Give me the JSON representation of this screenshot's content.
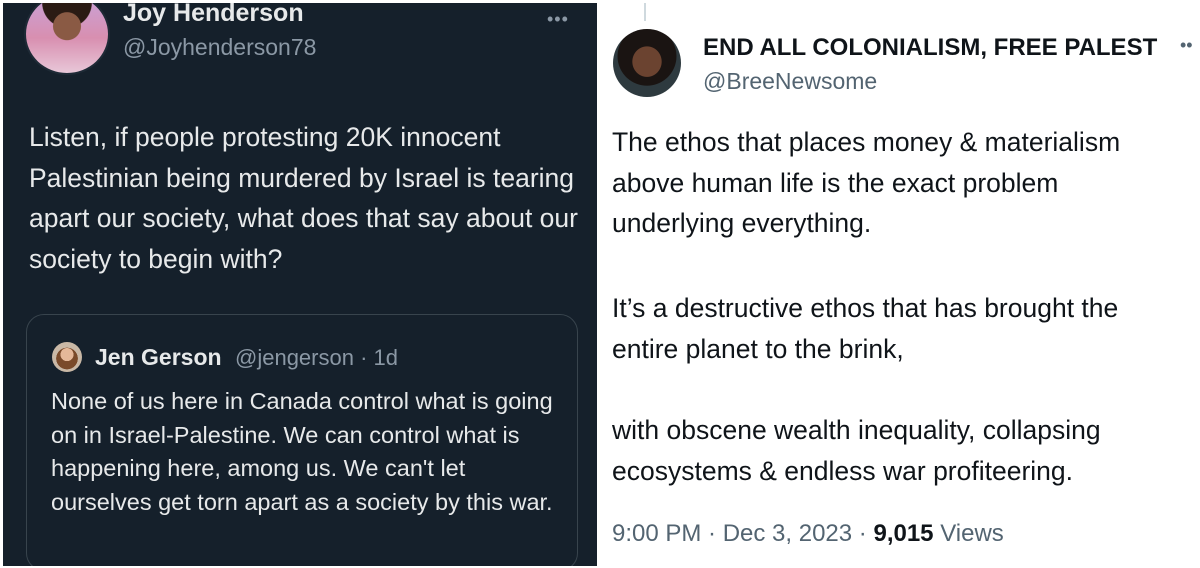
{
  "left_tweet": {
    "author_name": "Joy Henderson",
    "author_handle": "@Joyhenderson78",
    "more_menu": "•••",
    "text": "Listen, if people protesting 20K innocent Palestinian being murdered by Israel is tearing apart our society, what does that say about our society to begin with?",
    "quoted_tweet": {
      "author_name": "Jen Gerson",
      "author_handle_time": "@jengerson · 1d",
      "text": "None of us here in Canada control what is going on in Israel-Palestine. We can control what is happening here, among us. We can't let ourselves get torn apart as a society by this war."
    }
  },
  "right_tweet": {
    "author_name": "END ALL COLONIALISM, FREE PALEST",
    "author_handle": "@BreeNewsome",
    "more_menu": "••",
    "paragraphs": [
      [
        "The ethos that places money & materialism",
        "above human life is the exact problem",
        "underlying everything."
      ],
      [
        "It’s a destructive ethos that has brought the",
        "entire planet to the brink,"
      ],
      [
        "with obscene wealth inequality, collapsing",
        "ecosystems & endless war profiteering."
      ]
    ],
    "timestamp": "9:00 PM · Dec 3, 2023 · ",
    "views_count": "9,015",
    "views_label": " Views"
  },
  "colors": {
    "dark_bg": "#15202b",
    "dark_text": "#e7e9ea",
    "dark_secondary": "#8b98a5",
    "light_text": "#0f1419",
    "light_secondary": "#536471"
  }
}
